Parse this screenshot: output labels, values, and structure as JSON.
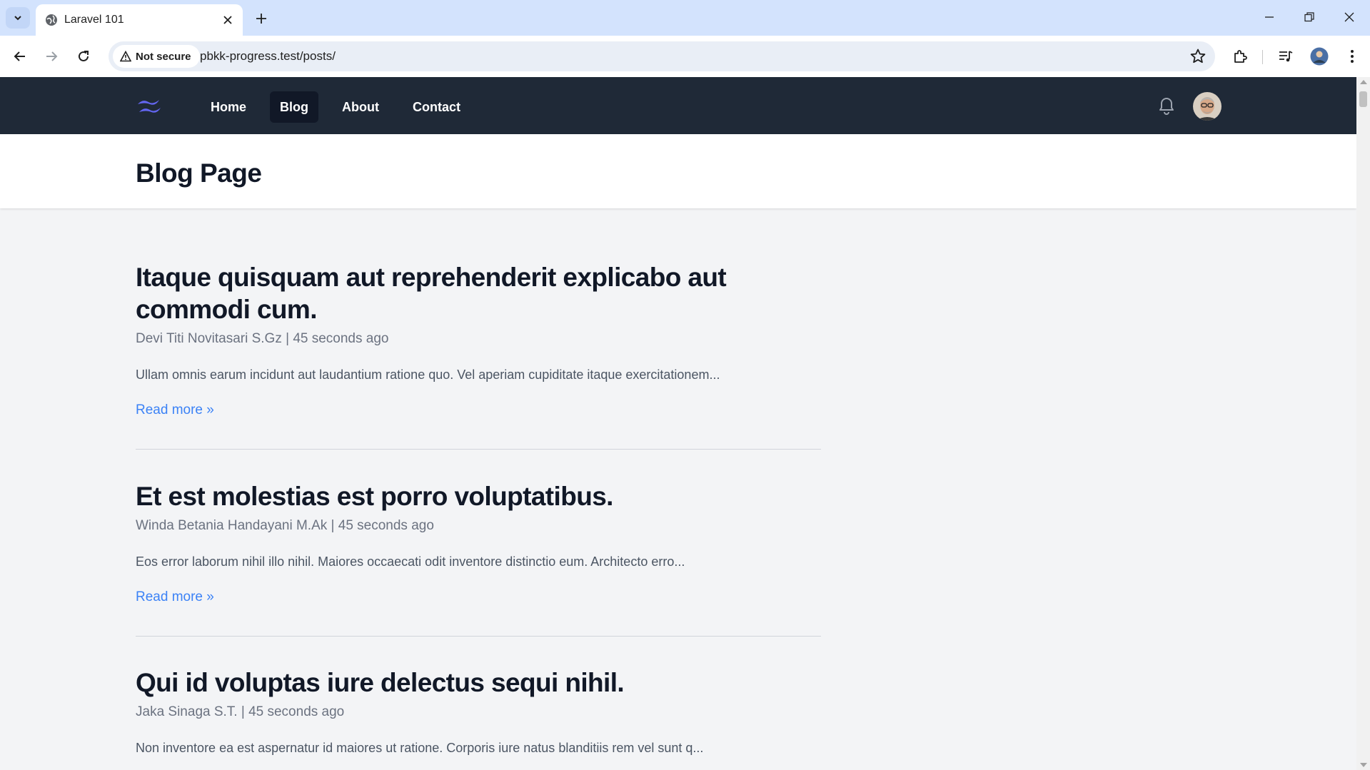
{
  "browser": {
    "tab_title": "Laravel 101",
    "security_label": "Not secure",
    "url": "pbkk-progress.test/posts/"
  },
  "site": {
    "nav": [
      {
        "label": "Home",
        "active": false
      },
      {
        "label": "Blog",
        "active": true
      },
      {
        "label": "About",
        "active": false
      },
      {
        "label": "Contact",
        "active": false
      }
    ],
    "colors": {
      "nav_bg": "#1f2937",
      "active_bg": "#111827",
      "link": "#3b82f6",
      "logo": "#6366f1"
    }
  },
  "page": {
    "title": "Blog Page"
  },
  "posts": [
    {
      "title_line1": "Itaque quisquam aut reprehenderit explicabo aut",
      "title_line2": "commodi cum.",
      "meta": "Devi Titi Novitasari S.Gz | 45 seconds ago",
      "excerpt": "Ullam omnis earum incidunt aut laudantium ratione quo. Vel aperiam cupiditate itaque exercitationem...",
      "read_more": "Read more »"
    },
    {
      "title_line1": "Et est molestias est porro voluptatibus.",
      "meta": "Winda Betania Handayani M.Ak | 45 seconds ago",
      "excerpt": "Eos error laborum nihil illo nihil. Maiores occaecati odit inventore distinctio eum. Architecto erro...",
      "read_more": "Read more »"
    },
    {
      "title_line1": "Qui id voluptas iure delectus sequi nihil.",
      "meta": "Jaka Sinaga S.T. | 45 seconds ago",
      "excerpt": "Non inventore ea est aspernatur id maiores ut ratione. Corporis iure natus blanditiis rem vel sunt q..."
    }
  ]
}
